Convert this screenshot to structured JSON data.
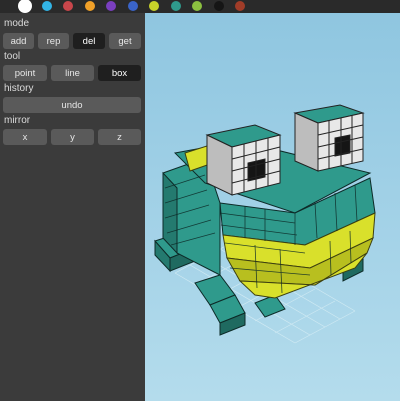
{
  "palette": {
    "colors": [
      "#ffffff",
      "#32b4e6",
      "#c8464b",
      "#f0a028",
      "#7a3fbf",
      "#3a64c8",
      "#c8d22a",
      "#2f9a8c",
      "#8cc040",
      "#151515",
      "#a03c28"
    ],
    "selected_index": 0
  },
  "sidebar": {
    "mode": {
      "label": "mode",
      "buttons": [
        {
          "label": "add",
          "active": false
        },
        {
          "label": "rep",
          "active": false
        },
        {
          "label": "del",
          "active": true
        },
        {
          "label": "get",
          "active": false
        }
      ]
    },
    "tool": {
      "label": "tool",
      "buttons": [
        {
          "label": "point",
          "active": false
        },
        {
          "label": "line",
          "active": false
        },
        {
          "label": "box",
          "active": true
        }
      ]
    },
    "history": {
      "label": "history",
      "undo_label": "undo"
    },
    "mirror": {
      "label": "mirror",
      "buttons": [
        {
          "label": "x"
        },
        {
          "label": "y"
        },
        {
          "label": "z"
        }
      ]
    }
  },
  "viewport": {
    "background_color": "#a3d2e8",
    "model": "voxel-frog",
    "colors": {
      "body": "#2f9a8c",
      "belly": "#d9e02b",
      "eye_white": "#e8e8e8",
      "pupil": "#151515"
    }
  }
}
